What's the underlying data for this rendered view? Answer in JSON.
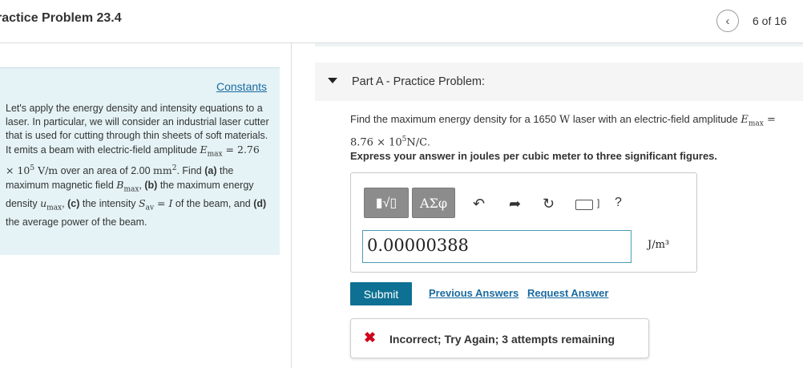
{
  "header": {
    "title": "ractice Problem 23.4",
    "prev_icon": "chevron-left-icon",
    "counter": "6 of 16"
  },
  "left_panel": {
    "constants_link": "Constants",
    "intro": [
      {
        "t": "Let's apply the energy density and intensity equations to a laser. In particular, we will consider an industrial laser cutter that is used for cutting through thin sheets of soft materials. It emits a beam with electric-field amplitude "
      },
      {
        "t": "E",
        "m": "i"
      },
      {
        "t": "max",
        "m": "sub"
      },
      {
        "t": " = 2.76 × 10",
        "m": "r"
      },
      {
        "t": "5",
        "m": "sup"
      },
      {
        "t": " V/m",
        "m": "r"
      },
      {
        "t": " over an area of 2.00 "
      },
      {
        "t": "mm",
        "m": "r"
      },
      {
        "t": "2",
        "m": "sup"
      },
      {
        "t": ". Find "
      },
      {
        "t": "(a)",
        "m": "b"
      },
      {
        "t": " the maximum magnetic field "
      },
      {
        "t": "B",
        "m": "i"
      },
      {
        "t": "max",
        "m": "sub"
      },
      {
        "t": ", "
      },
      {
        "t": "(b)",
        "m": "b"
      },
      {
        "t": " the maximum energy density "
      },
      {
        "t": "u",
        "m": "i"
      },
      {
        "t": "max",
        "m": "sub"
      },
      {
        "t": ", "
      },
      {
        "t": "(c)",
        "m": "b"
      },
      {
        "t": " the intensity "
      },
      {
        "t": "S",
        "m": "i"
      },
      {
        "t": "av",
        "m": "sub"
      },
      {
        "t": " = ",
        "m": "r"
      },
      {
        "t": "I",
        "m": "i"
      },
      {
        "t": " of the beam, and "
      },
      {
        "t": "(d)",
        "m": "b"
      },
      {
        "t": " the average power of the beam."
      }
    ]
  },
  "part": {
    "title": "Part A - Practice Problem:",
    "question": [
      {
        "t": "Find the maximum energy density for a 1650 "
      },
      {
        "t": "W",
        "m": "r"
      },
      {
        "t": " laser with an electric-field amplitude "
      },
      {
        "t": "E",
        "m": "i"
      },
      {
        "t": "max",
        "m": "sub"
      },
      {
        "t": " = 8.76 × 10",
        "m": "r"
      },
      {
        "t": "5",
        "m": "sup"
      },
      {
        "t": "N/C",
        "m": "r"
      },
      {
        "t": "."
      }
    ],
    "instruction": "Express your answer in joules per cubic meter to three significant figures."
  },
  "toolbar": {
    "template_label": "▮√▯",
    "greek_label": "ΑΣφ",
    "undo_icon": "undo-icon",
    "redo_icon": "redo-icon",
    "reset_icon": "reset-icon",
    "keyboard_icon": "keyboard-icon",
    "help_label": "?"
  },
  "answer": {
    "value": "0.00000388",
    "unit": "J/m³"
  },
  "actions": {
    "submit_label": "Submit",
    "previous_answers": "Previous Answers",
    "request_answer": "Request Answer"
  },
  "feedback": {
    "icon": "x-icon",
    "text": "Incorrect; Try Again; 3 attempts remaining",
    "color": "#d0021b"
  }
}
